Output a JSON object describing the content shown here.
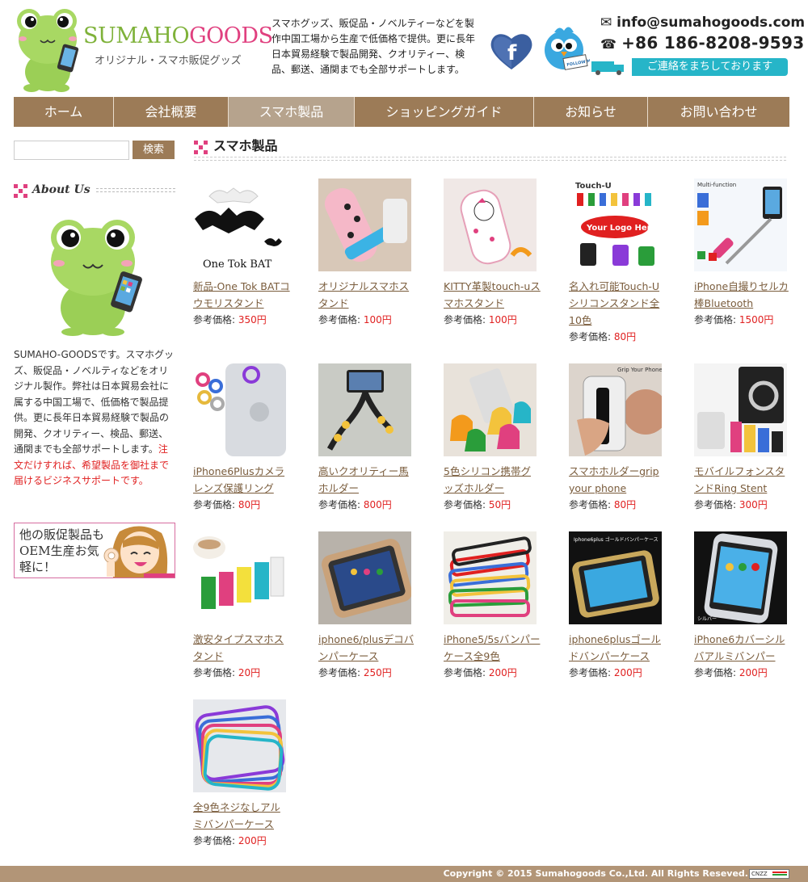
{
  "header": {
    "logo_part1": "SUMAHO",
    "logo_part2": "GOODS",
    "logo_sub": "オリジナル・スマホ販促グッズ",
    "desc": "スマホグッズ、販促品・ノベルティーなどを製作中国工場から生産で低価格で提供。更に長年日本貿易経験で製品開発、クオリティー、検品、郵送、通関までも全部サポートします。",
    "email": "info@sumahogoods.com",
    "phone": "+86 186-8208-9593",
    "contact_note": "ご連絡をまちしております",
    "bird_badge": "FOLLOW ME"
  },
  "nav": [
    {
      "label": "ホーム"
    },
    {
      "label": "会社概要"
    },
    {
      "label": "スマホ製品"
    },
    {
      "label": "ショッピングガイド"
    },
    {
      "label": "お知らせ"
    },
    {
      "label": "お問い合わせ"
    }
  ],
  "nav_active_index": 2,
  "sidebar": {
    "search": {
      "value": "",
      "button_label": "検索"
    },
    "about_title": "About Us",
    "about_text": "SUMAHO-GOODSです。スマホグッズ、販促品・ノベルティなどをオリジナル製作。弊社は日本貿易会社に属する中国工場で、低価格で製品提供。更に長年日本貿易経験で製品の開発、クオリティー、検品、郵送、通関までも全部サポートします。",
    "about_text_red": "注文だけすれば、希望製品を御社まで届けるビジネスサポートです。",
    "promo_text": "他の販促製品もOEM生産お気軽に！"
  },
  "main": {
    "title": "スマホ製品",
    "price_label": "参考価格: ",
    "products": [
      {
        "name": "新品-One Tok BATコウモリスタンド",
        "price": "350円",
        "img_text": "One Tok BAT",
        "icon": "bat-stand"
      },
      {
        "name": "オリジナルスマホスタンド",
        "price": "100円",
        "img_text": "",
        "icon": "polka-stand"
      },
      {
        "name": "KITTY革製touch-uスマホスタンド",
        "price": "100円",
        "img_text": "",
        "icon": "kitty-stand"
      },
      {
        "name": "名入れ可能Touch-Uシリコンスタンド全10色",
        "price": "80円",
        "img_text": "Your Logo Here",
        "icon": "touch-u"
      },
      {
        "name": "iPhone自撮りセルカ棒Bluetooth",
        "price": "1500円",
        "img_text": "Multi-function",
        "icon": "selfie-stick"
      },
      {
        "name": "iPhone6Plusカメラレンズ保護リング",
        "price": "80円",
        "img_text": "",
        "icon": "lens-ring"
      },
      {
        "name": "高いクオリティー馬ホルダー",
        "price": "800円",
        "img_text": "",
        "icon": "horse-holder"
      },
      {
        "name": "5色シリコン携帯グッズホルダー",
        "price": "50円",
        "img_text": "",
        "icon": "elephant-holder"
      },
      {
        "name": "スマホホルダーgrip your phone",
        "price": "80円",
        "img_text": "Grip Your Phone",
        "icon": "grip"
      },
      {
        "name": "モバイルフォンスタンドRing Stent",
        "price": "300円",
        "img_text": "",
        "icon": "ring-stent"
      },
      {
        "name": "激安タイプスマホスタンド",
        "price": "20円",
        "img_text": "",
        "icon": "cheap-stand"
      },
      {
        "name": "iphone6/plusデコバンパーケース",
        "price": "250円",
        "img_text": "",
        "icon": "deco-bumper"
      },
      {
        "name": "iPhone5/5sバンパーケース全9色",
        "price": "200円",
        "img_text": "",
        "icon": "bumper-stack"
      },
      {
        "name": "iphone6plusゴールドバンパーケース",
        "price": "200円",
        "img_text": "Iphone6plus ゴールドバンパーケース",
        "icon": "gold-bumper"
      },
      {
        "name": "iPhone6カバーシルバアルミバンパー",
        "price": "200円",
        "img_text": "シルバー",
        "icon": "silver-bumper"
      },
      {
        "name": "全9色ネジなしアルミバンパーケース",
        "price": "200円",
        "img_text": "",
        "icon": "screwless-bumper"
      }
    ]
  },
  "footer": {
    "copyright": "Copyright © 2015 Sumahogoods Co.,Ltd. All Rights Reseved.",
    "badge": "CNZZ"
  },
  "colors": {
    "nav_bg": "#9c7b57",
    "nav_active": "#b6a38d",
    "accent_pink": "#e0407f",
    "accent_green": "#7fb23a",
    "price_red": "#e02020",
    "link_brown": "#7a5c3c",
    "contact_teal": "#26b5c8",
    "footer_bg": "#b29577"
  }
}
